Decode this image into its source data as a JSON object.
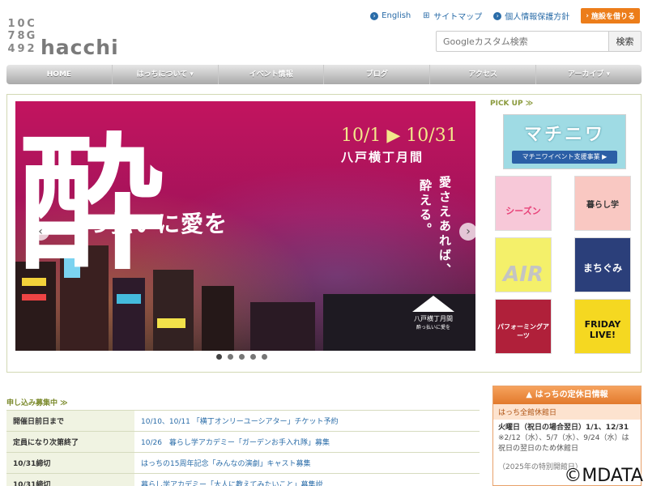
{
  "logo": {
    "mark_chars": [
      "1",
      "0",
      "C",
      "7",
      "8",
      "G",
      "4",
      "9",
      "2"
    ],
    "text": "hacchi"
  },
  "toplinks": {
    "english": "English",
    "sitemap": "サイトマップ",
    "privacy": "個人情報保護方針",
    "facility": "施設を借りる"
  },
  "search": {
    "placeholder": "Googleカスタム検索",
    "button": "検索"
  },
  "nav": [
    "HOME",
    "はっちについて ▾",
    "イベント情報",
    "ブログ",
    "アクセス",
    "アーカイブ ▾"
  ],
  "slider": {
    "date": "10/1 ▶ 10/31",
    "event": "八戸横丁月間",
    "big_char": "酔",
    "headline": "っ払いに愛を",
    "vertical1": "愛さえあれば、",
    "vertical2": "酔える。",
    "logo_text": "八戸横丁月間",
    "logo_sub": "酔っ払いに愛を"
  },
  "pickup": {
    "title": "PICK UP ≫",
    "main_banner": {
      "title": "マチニワ",
      "sub": "マチニワイベント支援事業 ▶"
    },
    "tiles": [
      {
        "name": "seasons",
        "text": "シーズン",
        "color": "#f7c8d8"
      },
      {
        "name": "kurashi",
        "text": "暮らし学",
        "color": "#f9c8c2"
      },
      {
        "name": "air",
        "text": "AIR",
        "color": "#f4f06a"
      },
      {
        "name": "machigumi",
        "text": "まちぐみ",
        "color": "#2b3f7a"
      },
      {
        "name": "performing",
        "text": "パフォーミングアーツ",
        "color": "#b0203a"
      },
      {
        "name": "friday",
        "text": "FRIDAY LIVE!",
        "color": "#f5d821"
      }
    ]
  },
  "apply": {
    "title": "申し込み募集中 ≫",
    "rows": [
      {
        "label": "開催日前日まで",
        "text": "10/10、10/11 「横丁オンリーユーシアター」チケット予約"
      },
      {
        "label": "定員になり次第終了",
        "text": "10/26　暮らし学アカデミー「ガーデンお手入れ隊」募集"
      },
      {
        "label": "10/31締切",
        "text": "はっちの15周年記念「みんなの演劇」キャスト募集"
      },
      {
        "label": "10/31締切",
        "text": "暮らし学アカデミー「大人に教えてみたいこと」募集説"
      }
    ]
  },
  "closed": {
    "title": "▲ はっちの定休日情報",
    "sub": "はっち全館休館日",
    "line1": "火曜日（祝日の場合翌日）1/1、12/31",
    "line2": "※2/12（水）、5/7（水）、9/24（水）は祝日の翌日のため休館日",
    "line3": "（2025年の特別開館日）"
  },
  "watermark": "©MDATA"
}
